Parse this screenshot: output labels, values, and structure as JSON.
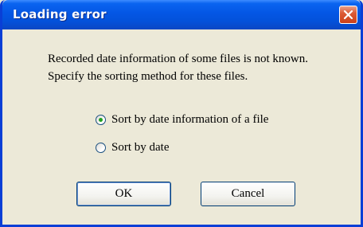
{
  "window": {
    "title": "Loading error"
  },
  "message": {
    "line1": "Recorded date information of some files is not known.",
    "line2": "Specify the sorting method for these files."
  },
  "options": [
    {
      "label": "Sort by date information of a file",
      "selected": true
    },
    {
      "label": "Sort by date",
      "selected": false
    }
  ],
  "buttons": {
    "ok": "OK",
    "cancel": "Cancel"
  },
  "icons": {
    "close": "close-icon"
  },
  "colors": {
    "titlebar": "#0456e4",
    "close_button": "#dc5b36",
    "window_bg": "#ece9d8"
  }
}
